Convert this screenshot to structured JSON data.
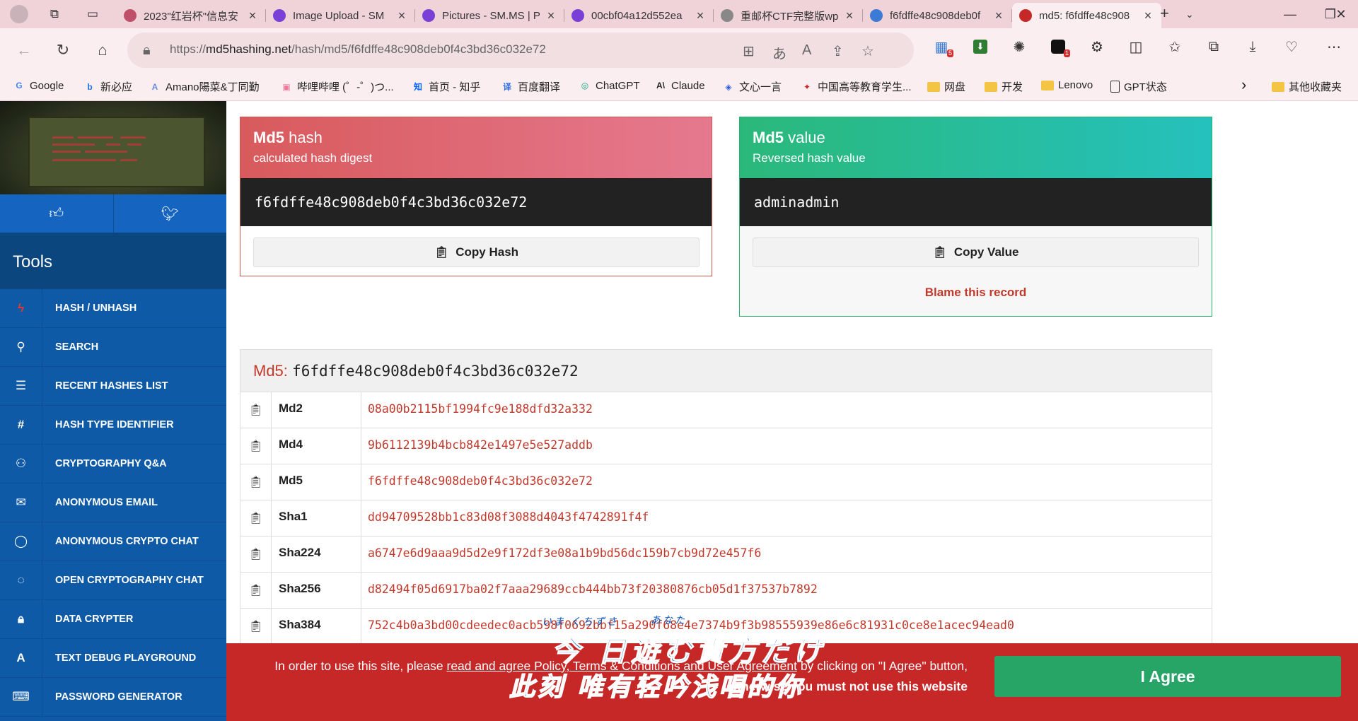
{
  "browser": {
    "tabs": [
      {
        "title": "2023\"红岩杯\"信息安",
        "fav_color": "#c0506a"
      },
      {
        "title": "Image Upload - SM",
        "fav_color": "#7a3fd6"
      },
      {
        "title": "Pictures - SM.MS | P",
        "fav_color": "#7a3fd6"
      },
      {
        "title": "00cbf04a12d552ea",
        "fav_color": "#7a3fd6"
      },
      {
        "title": "重邮杯CTF完整版wp",
        "fav_color": "#888888"
      },
      {
        "title": "f6fdffe48c908deb0f",
        "fav_color": "#3b7bd6"
      },
      {
        "title": "md5: f6fdffe48c908",
        "fav_color": "#c62828"
      }
    ],
    "url_prefix": "https://",
    "url_host": "md5hashing.net",
    "url_path": "/hash/md5/f6fdffe48c908deb0f4c3bd36c032e72",
    "bookmarks": [
      {
        "label": "Google",
        "icon": "G"
      },
      {
        "label": "新必应",
        "icon": "b"
      },
      {
        "label": "Amano陽菜&丁同勤",
        "icon": "A"
      },
      {
        "label": "哔哩哔哩 (゜-゜)つ...",
        "icon": "▣"
      },
      {
        "label": "首页 - 知乎",
        "icon": "知"
      },
      {
        "label": "百度翻译",
        "icon": "译"
      },
      {
        "label": "ChatGPT",
        "icon": "◎"
      },
      {
        "label": "Claude",
        "icon": "A\\"
      },
      {
        "label": "文心一言",
        "icon": "◈"
      },
      {
        "label": "中国高等教育学生...",
        "icon": "✦"
      },
      {
        "label": "网盘",
        "icon": "folder"
      },
      {
        "label": "开发",
        "icon": "folder"
      },
      {
        "label": "Lenovo",
        "icon": "folder"
      },
      {
        "label": "GPT状态",
        "icon": "doc"
      }
    ],
    "other_bookmarks": "其他收藏夹",
    "ext_badges": [
      "5",
      "1"
    ]
  },
  "sidebar": {
    "tools_title": "Tools",
    "items": [
      {
        "label": "HASH / UNHASH",
        "icon": "bolt-icon",
        "glyph": "ϟ",
        "color": "#e53935"
      },
      {
        "label": "SEARCH",
        "icon": "search-icon",
        "glyph": "⚲",
        "color": "#ffffff"
      },
      {
        "label": "RECENT HASHES LIST",
        "icon": "list-icon",
        "glyph": "☰",
        "color": "#ffffff"
      },
      {
        "label": "HASH TYPE IDENTIFIER",
        "icon": "hashtag-icon",
        "glyph": "#",
        "color": "#ffffff"
      },
      {
        "label": "CRYPTOGRAPHY Q&A",
        "icon": "qa-icon",
        "glyph": "⚇",
        "color": "#ffffff"
      },
      {
        "label": "ANONYMOUS EMAIL",
        "icon": "envelope-icon",
        "glyph": "✉",
        "color": "#ffffff"
      },
      {
        "label": "ANONYMOUS CRYPTO CHAT",
        "icon": "chat-bubble-icon",
        "glyph": "◯",
        "color": "#ffffff"
      },
      {
        "label": "OPEN CRYPTOGRAPHY CHAT",
        "icon": "chat-bubbles-icon",
        "glyph": "◌",
        "color": "#ffffff"
      },
      {
        "label": "DATA CRYPTER",
        "icon": "lock-icon",
        "glyph": "🔒︎",
        "color": "#ffffff"
      },
      {
        "label": "TEXT DEBUG PLAYGROUND",
        "icon": "font-icon",
        "glyph": "A",
        "color": "#ffffff"
      },
      {
        "label": "PASSWORD GENERATOR",
        "icon": "keyboard-icon",
        "glyph": "⌨",
        "color": "#ffffff"
      }
    ]
  },
  "hash_card": {
    "title_bold": "Md5",
    "title_rest": " hash",
    "subtitle": "calculated hash digest",
    "value": "f6fdffe48c908deb0f4c3bd36c032e72",
    "copy_label": "Copy Hash"
  },
  "value_card": {
    "title_bold": "Md5",
    "title_rest": " value",
    "subtitle": "Reversed hash value",
    "value": "adminadmin",
    "copy_label": "Copy Value",
    "blame_label": "Blame this record"
  },
  "table": {
    "head_label": "Md5:",
    "head_value": "f6fdffe48c908deb0f4c3bd36c032e72",
    "rows": [
      {
        "algo": "Md2",
        "hash": "08a00b2115bf1994fc9e188dfd32a332"
      },
      {
        "algo": "Md4",
        "hash": "9b6112139b4bcb842e1497e5e527addb"
      },
      {
        "algo": "Md5",
        "hash": "f6fdffe48c908deb0f4c3bd36c032e72"
      },
      {
        "algo": "Sha1",
        "hash": "dd94709528bb1c83d08f3088d4043f4742891f4f"
      },
      {
        "algo": "Sha224",
        "hash": "a6747e6d9aaa9d5d2e9f172df3e08a1b9bd56dc159b7cb9d72e457f6"
      },
      {
        "algo": "Sha256",
        "hash": "d82494f05d6917ba02f7aaa29689ccb444bb73f20380876cb05d1f37537b7892"
      },
      {
        "algo": "Sha384",
        "hash": "752c4b0a3bd00cdeedec0acb598f0692bbf15a290f68e4e7374b9f3b98555939e86e6c81931c0ce8e1acec94ead0"
      }
    ]
  },
  "consent": {
    "line1_pre": "In order to use this site, please ",
    "line1_link": "read and agree Policy, Terms & Conditions and User Agreement",
    "line1_post": " by clicking on \"I Agree\" button,",
    "line2": "otherwise you must not use this website",
    "agree_label": "I Agree"
  },
  "overlay": {
    "line1": "今 日遊む貴方だけ",
    "ruby1": "いま くちずさ",
    "ruby2": "あなた",
    "line2": "此刻 唯有轻吟浅唱的你"
  },
  "colors": {
    "sidebar": "#0e5aa7",
    "hash_accent": "#d9534f",
    "value_accent": "#29b36f",
    "hash_text": "#c0392b",
    "consent_bg": "#c62828",
    "agree_bg": "#27a567"
  }
}
